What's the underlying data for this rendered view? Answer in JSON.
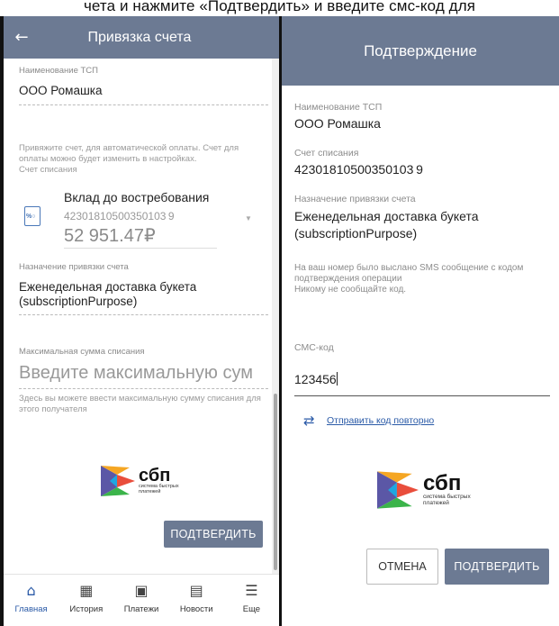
{
  "caption": "чета и нажмите «Подтвердить» и введите смс-код для",
  "left": {
    "header": {
      "back_icon": "arrow-left-icon",
      "title": "Привязка счета"
    },
    "merchant": {
      "label": "Наименование ТСП",
      "value": "ООО Ромашка"
    },
    "account_hint": "Привяжите счет, для автоматической оплаты. Счет для оплаты можно будет изменить в настройках.",
    "account_label": "Счет списания",
    "account": {
      "name": "Вклад до востребования",
      "number": "42301810500350103 9",
      "balance": "52 951.47₽"
    },
    "purpose": {
      "label": "Назначение привязки счета",
      "line1": "Еженедельная доставка букета",
      "line2": "(subscriptionPurpose)"
    },
    "max_sum": {
      "label": "Максимальная сумма списания",
      "placeholder": "Введите максимальную сум",
      "hint": "Здесь вы можете ввести максимальную сумму списания для этого получателя"
    },
    "sbp": {
      "big": "сбп",
      "small1": "система быстрых",
      "small2": "платежей"
    },
    "confirm_label": "ПОДТВЕРДИТЬ",
    "tabs": [
      {
        "label": "Главная",
        "icon": "home-icon"
      },
      {
        "label": "История",
        "icon": "calendar-icon"
      },
      {
        "label": "Платежи",
        "icon": "wallet-icon"
      },
      {
        "label": "Новости",
        "icon": "chat-icon"
      },
      {
        "label": "Еще",
        "icon": "menu-icon"
      }
    ]
  },
  "right": {
    "header": {
      "title": "Подтверждение"
    },
    "merchant": {
      "label": "Наименование ТСП",
      "value": "ООО Ромашка"
    },
    "account": {
      "label": "Счет списания",
      "value": "42301810500350103 9"
    },
    "purpose": {
      "label": "Назначение привязки счета",
      "line1": "Еженедельная доставка букета",
      "line2": "(subscriptionPurpose)"
    },
    "sms_hint": [
      "На ваш номер было выслано SMS сообщение с кодом",
      "подтверждения операции",
      "Никому не сообщайте код."
    ],
    "sms": {
      "label": "СМС-код",
      "value": "123456"
    },
    "resend_label": "Отправить код повторно",
    "sbp": {
      "big": "сбп",
      "small1": "система быстрых",
      "small2": "платежей"
    },
    "cancel_label": "ОТМЕНА",
    "confirm_label": "ПОДТВЕРДИТЬ"
  },
  "colors": {
    "header": "#6c7a93",
    "link": "#2a5aa7",
    "button": "#6c7a93"
  }
}
